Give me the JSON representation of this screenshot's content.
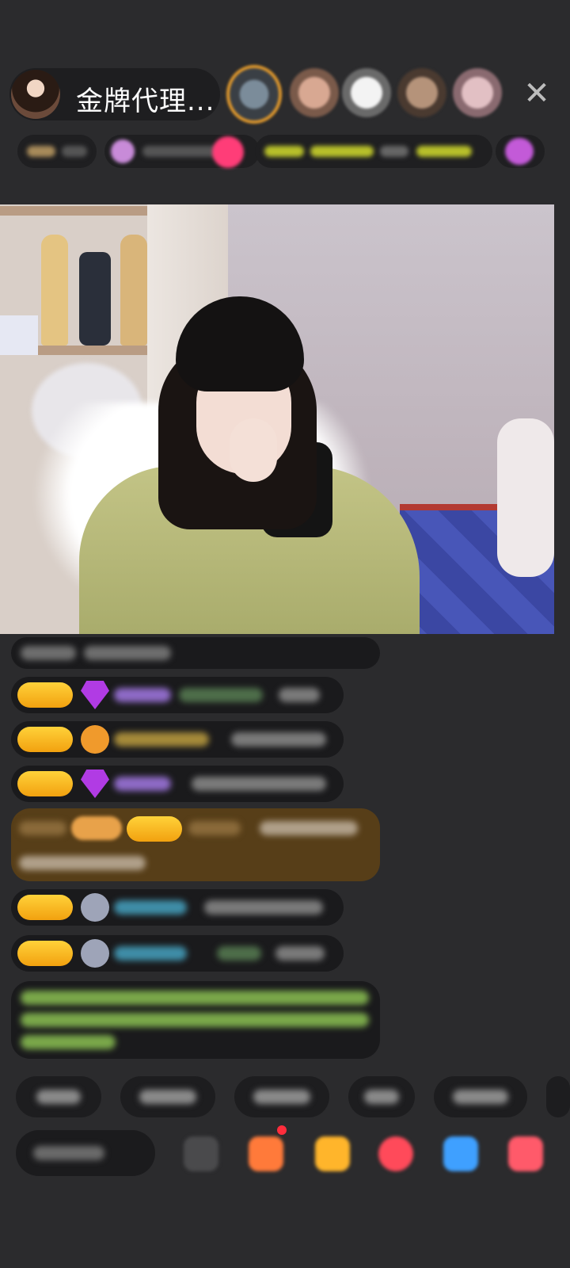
{
  "header": {
    "host_name": "金牌代理...",
    "close_icon": "close-x-icon"
  },
  "viewers": [
    {
      "color": "#8a6a4a",
      "top_rank": true
    },
    {
      "color": "#b08a74"
    },
    {
      "color": "#d8d6d6"
    },
    {
      "color": "#9a7a62"
    },
    {
      "color": "#c7a4a6"
    }
  ],
  "info_row": {
    "chips": 4
  },
  "chat": {
    "messages": [
      {
        "kind": "plain"
      },
      {
        "kind": "badge",
        "icon": "gem-icon"
      },
      {
        "kind": "badge",
        "icon": "ring-icon"
      },
      {
        "kind": "badge",
        "icon": "gem-icon"
      },
      {
        "kind": "highlight"
      },
      {
        "kind": "badge",
        "icon": "cloud-icon"
      },
      {
        "kind": "badge",
        "icon": "cloud-icon"
      },
      {
        "kind": "green-notice"
      }
    ]
  },
  "quick_replies": 6,
  "bottom_bar": {
    "icons": [
      "more-icon",
      "gift-box-icon",
      "gift-icon",
      "heart-icon",
      "message-icon",
      "grid-icon"
    ],
    "colors": [
      "#4a4a4c",
      "#ff7a3a",
      "#ffb52b",
      "#ff4a5a",
      "#3fa0ff",
      "#ff5a6a"
    ]
  }
}
